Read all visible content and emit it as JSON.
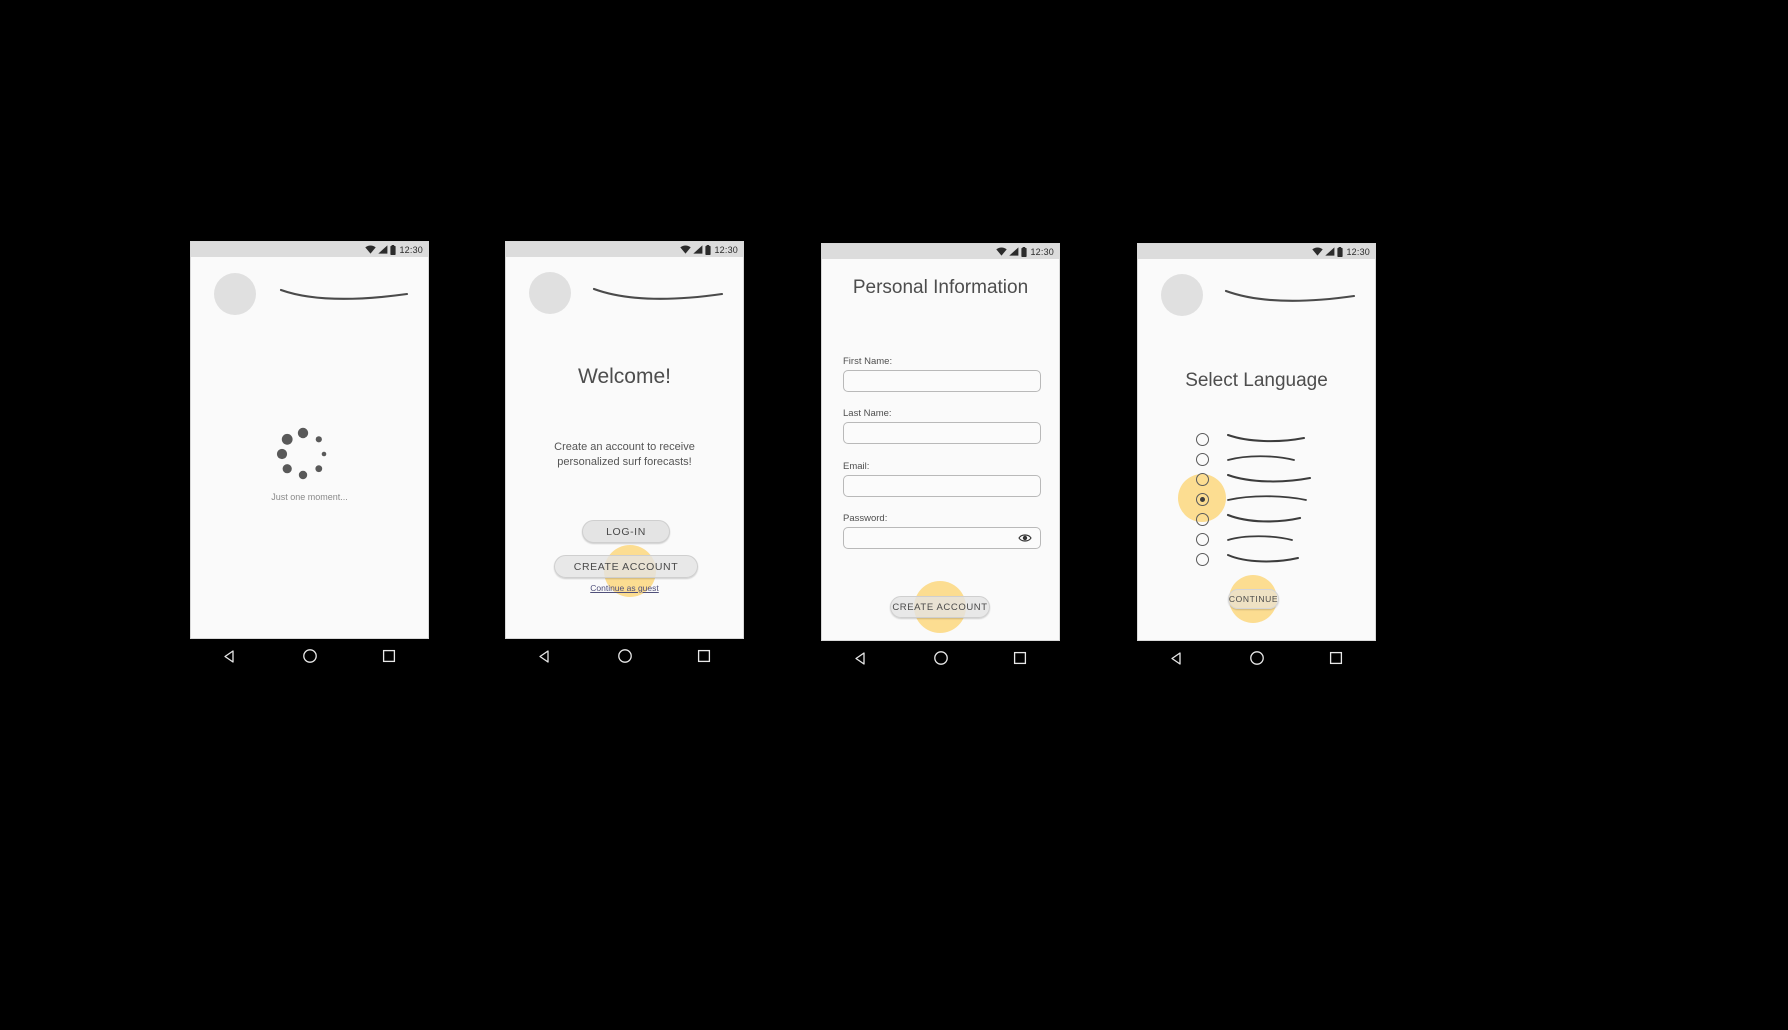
{
  "meta": {
    "background_color": "#000000",
    "screen_color": "#fafafa",
    "accent_color": "#fcd77e",
    "statusbar_color": "#dcdcdc"
  },
  "status_bar": {
    "time": "12:30",
    "icons": [
      "wifi-icon",
      "signal-icon",
      "battery-icon"
    ]
  },
  "nav_bar": {
    "back_label": "back-button",
    "home_label": "home-button",
    "recents_label": "recents-button"
  },
  "screens": [
    {
      "id": "loading",
      "name": "Loading Screen",
      "avatar": "logo-placeholder",
      "squiggle": "app-name-placeholder",
      "spinner": "loading-spinner",
      "status_text": "Just one moment..."
    },
    {
      "id": "welcome",
      "name": "Welcome Screen",
      "avatar": "logo-placeholder",
      "squiggle": "app-name-placeholder",
      "title": "Welcome!",
      "body": [
        "Create an account to receive",
        "personalized surf forecasts!"
      ],
      "buttons": [
        {
          "label": "LOG-IN",
          "name": "log-in-button"
        },
        {
          "label": "CREATE ACCOUNT",
          "name": "create-account-button"
        }
      ],
      "guest_link": "Continue as guest",
      "tap_target": "create-account-button"
    },
    {
      "id": "personal-information",
      "name": "Personal Information Screen",
      "title": "Personal Information",
      "fields": [
        {
          "label": "First Name:",
          "value": "",
          "name": "first-name-field",
          "has_eye": false
        },
        {
          "label": "Last Name:",
          "value": "",
          "name": "last-name-field",
          "has_eye": false
        },
        {
          "label": "Email:",
          "value": "",
          "name": "email-field",
          "has_eye": false
        },
        {
          "label": "Password:",
          "value": "",
          "name": "password-field",
          "has_eye": true
        }
      ],
      "submit_button": {
        "label": "CREATE ACCOUNT",
        "name": "create-account-submit-button"
      },
      "tap_target": "create-account-submit-button"
    },
    {
      "id": "select-language",
      "name": "Select Language Screen",
      "avatar": "logo-placeholder",
      "squiggle": "app-name-placeholder",
      "title": "Select Language",
      "options": [
        {
          "label": "language-option-1",
          "selected": false
        },
        {
          "label": "language-option-2",
          "selected": false
        },
        {
          "label": "language-option-3",
          "selected": false
        },
        {
          "label": "language-option-4",
          "selected": true
        },
        {
          "label": "language-option-5",
          "selected": false
        },
        {
          "label": "language-option-6",
          "selected": false
        },
        {
          "label": "language-option-7",
          "selected": false
        }
      ],
      "continue_button": {
        "label": "CONTINUE",
        "name": "continue-button"
      },
      "tap_targets": [
        "language-option-4",
        "continue-button"
      ]
    }
  ]
}
